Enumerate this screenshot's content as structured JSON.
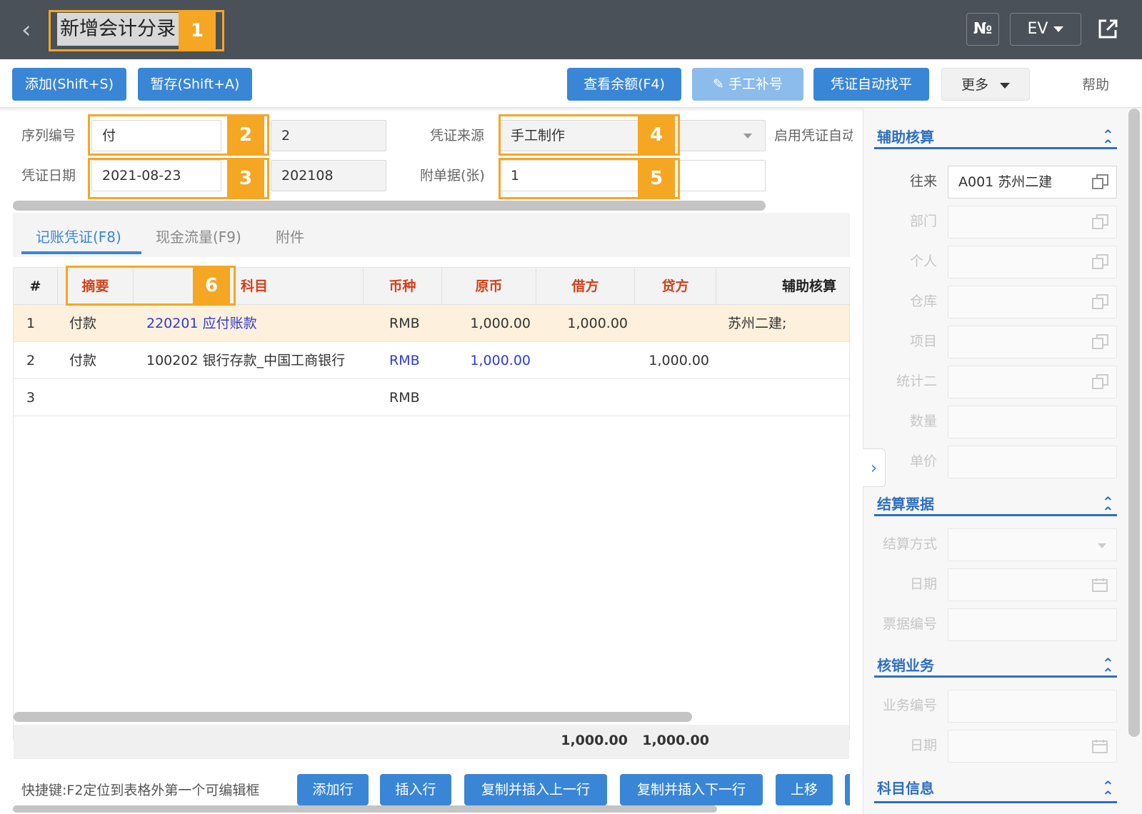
{
  "header": {
    "title": "新增会计分录",
    "no_label": "№",
    "ev_label": "EV"
  },
  "toolbar": {
    "add_label": "添加(Shift+S)",
    "save_draft_label": "暂存(Shift+A)",
    "balance_label": "查看余额(F4)",
    "manual_number_label": "手工补号",
    "auto_balance_label": "凭证自动找平",
    "more_label": "更多",
    "help_label": "帮助"
  },
  "form": {
    "sequence_label": "序列编号",
    "sequence_word": "付",
    "sequence_number": "2",
    "date_label": "凭证日期",
    "date_value": "2021-08-23",
    "period_value": "202108",
    "source_label": "凭证来源",
    "source_value": "手工制作",
    "attachments_label": "附单据(张)",
    "attachments_value": "1",
    "enable_label": "启用凭证自动"
  },
  "markers": [
    "1",
    "2",
    "3",
    "4",
    "5",
    "6"
  ],
  "tabs": [
    {
      "label": "记账凭证(F8)"
    },
    {
      "label": "现金流量(F9)"
    },
    {
      "label": "附件"
    }
  ],
  "grid": {
    "headers": {
      "index": "#",
      "summary": "摘要",
      "account": "科目",
      "currency": "币种",
      "original": "原币",
      "debit": "借方",
      "credit": "贷方",
      "auxiliary": "辅助核算"
    },
    "rows": [
      {
        "index": "1",
        "summary": "付款",
        "account": "220201 应付账款",
        "currency": "RMB",
        "original": "1,000.00",
        "debit": "1,000.00",
        "credit": "",
        "auxiliary": "苏州二建;"
      },
      {
        "index": "2",
        "summary": "付款",
        "account": "100202 银行存款_中国工商银行",
        "currency": "RMB",
        "original": "1,000.00",
        "debit": "",
        "credit": "1,000.00",
        "auxiliary": ""
      },
      {
        "index": "3",
        "summary": "",
        "account": "",
        "currency": "RMB",
        "original": "",
        "debit": "",
        "credit": "",
        "auxiliary": ""
      }
    ],
    "totals": {
      "debit": "1,000.00",
      "credit": "1,000.00"
    }
  },
  "bottom": {
    "hint": "快捷键:F2定位到表格外第一个可编辑框",
    "add_row": "添加行",
    "insert_row": "插入行",
    "copy_insert_above": "复制并插入上一行",
    "copy_insert_below": "复制并插入下一行",
    "move_up": "上移"
  },
  "right_panel": {
    "auxiliary": {
      "title": "辅助核算",
      "fields": [
        {
          "label": "往来",
          "value": "A001 苏州二建"
        },
        {
          "label": "部门",
          "value": ""
        },
        {
          "label": "个人",
          "value": ""
        },
        {
          "label": "仓库",
          "value": ""
        },
        {
          "label": "项目",
          "value": ""
        },
        {
          "label": "统计二",
          "value": ""
        },
        {
          "label": "数量",
          "value": ""
        },
        {
          "label": "单价",
          "value": ""
        }
      ]
    },
    "settlement": {
      "title": "结算票据",
      "fields": [
        {
          "label": "结算方式"
        },
        {
          "label": "日期"
        },
        {
          "label": "票据编号"
        }
      ]
    },
    "writeoff": {
      "title": "核销业务",
      "fields": [
        {
          "label": "业务编号"
        },
        {
          "label": "日期"
        }
      ]
    },
    "account_info": {
      "title": "科目信息"
    }
  },
  "colors": {
    "header_bg": "#4a5159",
    "primary": "#3a86d6",
    "highlight": "#f5a623",
    "header_text_red": "#d0421b",
    "link_blue": "#2f3bd1",
    "section_blue": "#2e6fc0"
  }
}
